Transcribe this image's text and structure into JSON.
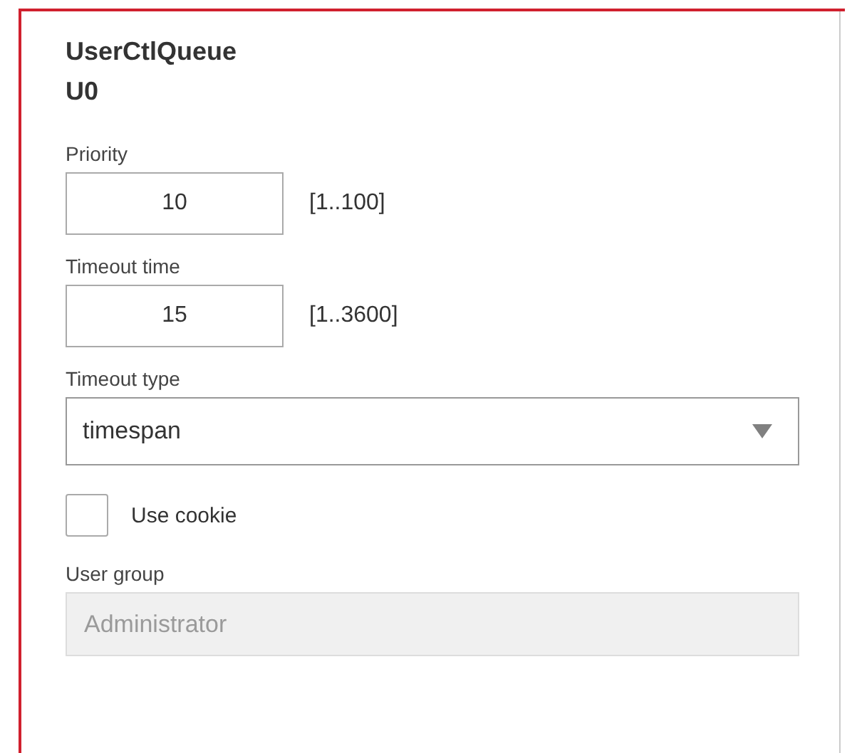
{
  "title": [
    "UserCtlQueue",
    "U0"
  ],
  "fields": [
    {
      "kind": "number",
      "label": "Priority",
      "value": "10",
      "range": "[1..100]"
    },
    {
      "kind": "number",
      "label": "Timeout time",
      "value": "15",
      "range": "[1..3600]"
    },
    {
      "kind": "select",
      "label": "Timeout type",
      "value": "timespan"
    },
    {
      "kind": "checkbox",
      "label": "Use cookie",
      "checked": false
    },
    {
      "kind": "text",
      "label": "User group",
      "value": "Administrator",
      "disabled": true
    }
  ]
}
